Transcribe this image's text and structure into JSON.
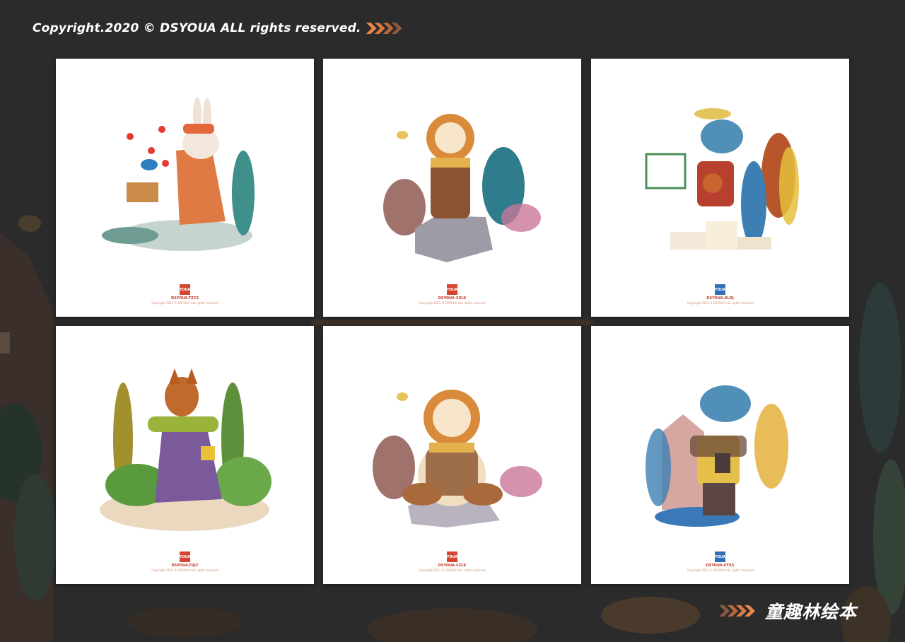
{
  "header": {
    "copyright": "Copyright.2020 © DSYOUA ALL rights reserved.",
    "chevron_colors": [
      "#e5894b",
      "#d97a3f",
      "#b8683a",
      "#8a5a40"
    ]
  },
  "footer": {
    "title": "童趣林绘本",
    "chevron_colors": [
      "#8a5a40",
      "#b8683a",
      "#d97a3f",
      "#e5894b"
    ]
  },
  "cards": [
    {
      "subject": "rabbit",
      "badge": "YOUA",
      "code": "DSYOUA-TZCZ",
      "rights": "Copyright 2021 © DSYOUA ALL rights reserved",
      "badge_color": "#d4452f"
    },
    {
      "subject": "lion",
      "badge": "YOUA",
      "code": "DSYOUA-SZLK",
      "rights": "Copyright 2021 © DSYOUA ALL rights reserved",
      "badge_color": "#d4452f"
    },
    {
      "subject": "dinosaur",
      "badge": "YOUA",
      "code": "DSYOUA-KLDJ",
      "rights": "Copyright 2021 © DSYOUA ALL rights reserved",
      "badge_color": "#2e6fb8"
    },
    {
      "subject": "fox",
      "badge": "YOUA",
      "code": "DSYOUA-TQLT",
      "rights": "Copyright 2021 © DSYOUA ALL rights reserved",
      "badge_color": "#d4452f"
    },
    {
      "subject": "lion",
      "badge": "YOUA",
      "code": "DSYOUA-SZLK",
      "rights": "Copyright 2021 © DSYOUA ALL rights reserved",
      "badge_color": "#d4452f"
    },
    {
      "subject": "dinosaur",
      "badge": "YOUA",
      "code": "DSYOUA-EYXS",
      "rights": "Copyright 2021 © DSYOUA ALL rights reserved",
      "badge_color": "#2e6fb8"
    }
  ]
}
